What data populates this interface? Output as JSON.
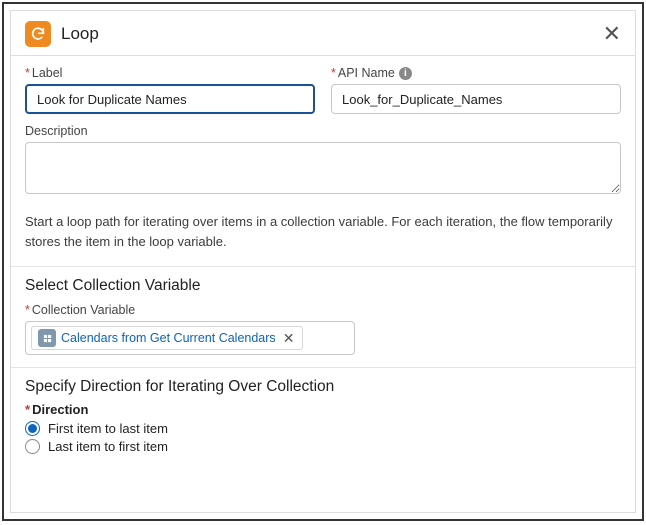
{
  "header": {
    "title": "Loop"
  },
  "fields": {
    "label_label": "Label",
    "label_value": "Look for Duplicate Names",
    "api_label": "API Name",
    "api_value": "Look_for_Duplicate_Names",
    "desc_label": "Description",
    "desc_value": ""
  },
  "help_text": "Start a loop path for iterating over items in a collection variable. For each iteration, the flow temporarily stores the item in the loop variable.",
  "collection": {
    "section_title": "Select Collection Variable",
    "field_label": "Collection Variable",
    "pill_text": "Calendars from Get Current Calendars"
  },
  "direction": {
    "section_title": "Specify Direction for Iterating Over Collection",
    "label": "Direction",
    "options": {
      "first": "First item to last item",
      "last": "Last item to first item"
    }
  }
}
